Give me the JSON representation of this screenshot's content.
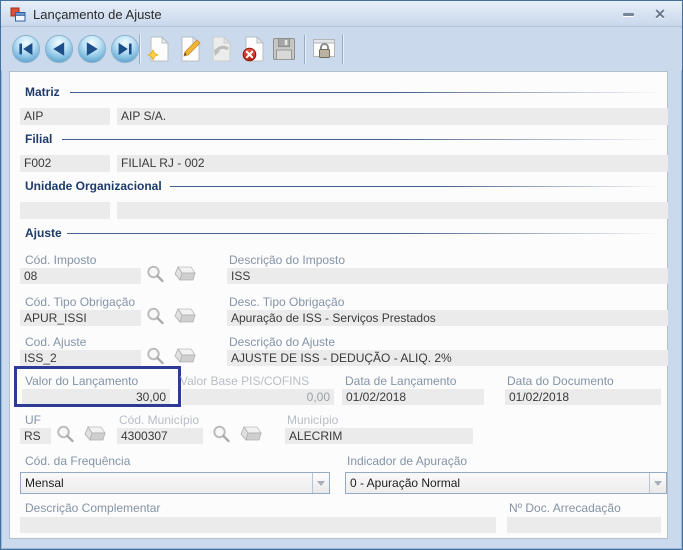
{
  "window": {
    "title": "Lançamento de Ajuste",
    "minimize_glyph": "–",
    "close_glyph": "✕"
  },
  "toolbar": {
    "icons": [
      "first-record",
      "previous-record",
      "next-record",
      "last-record",
      "new-record",
      "edit-record",
      "undo",
      "delete-record",
      "save",
      "lock"
    ]
  },
  "sections": {
    "matriz": {
      "title": "Matriz"
    },
    "filial": {
      "title": "Filial"
    },
    "unidade_organizacional": {
      "title": "Unidade Organizacional"
    },
    "ajuste": {
      "title": "Ajuste"
    }
  },
  "matriz": {
    "code": "AIP",
    "name": "AIP S/A."
  },
  "filial": {
    "code": "F002",
    "name": "FILIAL RJ - 002"
  },
  "unidade_organizacional": {
    "code": "",
    "name": ""
  },
  "fields": {
    "cod_imposto": {
      "label": "Cód. Imposto",
      "value": "08"
    },
    "desc_imposto": {
      "label": "Descrição do Imposto",
      "value": "ISS"
    },
    "cod_tipo_obrigacao": {
      "label": "Cód. Tipo Obrigação",
      "value": "APUR_ISSI"
    },
    "desc_tipo_obrigacao": {
      "label": "Desc. Tipo Obrigação",
      "value": "Apuração de ISS - Serviços Prestados"
    },
    "cod_ajuste": {
      "label": "Cod. Ajuste",
      "value": "ISS_2"
    },
    "desc_ajuste": {
      "label": "Descrição do Ajuste",
      "value": "AJUSTE DE ISS - DEDUÇÃO - ALIQ. 2%"
    },
    "valor_lancamento": {
      "label": "Valor do Lançamento",
      "value": "30,00"
    },
    "valor_base_pis_cofins": {
      "label": "Valor Base PIS/COFINS",
      "value": "0,00"
    },
    "data_lancamento": {
      "label": "Data de Lançamento",
      "value": "01/02/2018"
    },
    "data_documento": {
      "label": "Data do Documento",
      "value": "01/02/2018"
    },
    "uf": {
      "label": "UF",
      "value": "RS"
    },
    "cod_municipio": {
      "label": "Cód. Município",
      "value": "4300307"
    },
    "municipio": {
      "label": "Município",
      "value": "ALECRIM"
    },
    "cod_frequencia": {
      "label": "Cód. da Frequência",
      "value": "Mensal"
    },
    "indicador_apuracao": {
      "label": "Indicador de Apuração",
      "value": "0 - Apuração Normal"
    },
    "descricao_complementar": {
      "label": "Descrição Complementar",
      "value": ""
    },
    "num_doc_arrecadacao": {
      "label": "Nº Doc. Arrecadação",
      "value": ""
    }
  },
  "colors": {
    "highlight_box": "#2d3b96",
    "section_title": "#1d3a6b",
    "label": "#8493a6",
    "field_bg": "#ebebeb",
    "titlebar_bg": "#cadaec"
  }
}
